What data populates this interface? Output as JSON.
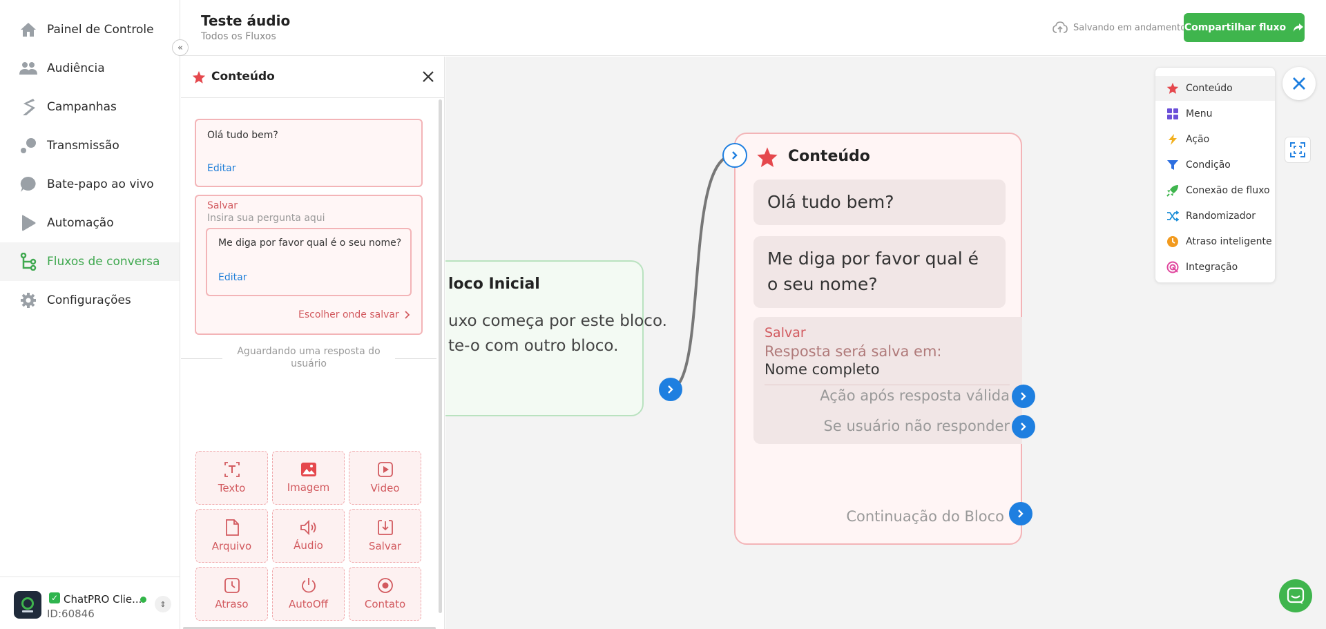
{
  "sidebar": {
    "items": [
      {
        "label": "Painel de Controle",
        "icon": "home-icon"
      },
      {
        "label": "Audiência",
        "icon": "people-icon"
      },
      {
        "label": "Campanhas",
        "icon": "campaign-icon"
      },
      {
        "label": "Transmissão",
        "icon": "broadcast-icon"
      },
      {
        "label": "Bate-papo ao vivo",
        "icon": "chat-bubble-icon"
      },
      {
        "label": "Automação",
        "icon": "play-icon"
      },
      {
        "label": "Fluxos de conversa",
        "icon": "flow-icon",
        "active": true
      },
      {
        "label": "Configurações",
        "icon": "gear-icon"
      }
    ],
    "footer": {
      "name": "ChatPRO Clie...",
      "id": "ID:60846"
    }
  },
  "header": {
    "title": "Teste áudio",
    "breadcrumb": "Todos os Fluxos",
    "saving": "Salvando em andamento",
    "share_label": "Compartilhar fluxo"
  },
  "panel": {
    "title": "Conteúdo",
    "message": "Olá tudo bem?",
    "edit_label": "Editar",
    "save_label": "Salvar",
    "save_placeholder": "Insira sua pergunta aqui",
    "question": "Me diga por favor qual é o seu nome?",
    "question_edit": "Editar",
    "choose_save": "Escolher onde salvar",
    "waiting": "Aguardando uma resposta do usuário",
    "buttons": [
      {
        "label": "Texto",
        "icon": "text-icon"
      },
      {
        "label": "Imagem",
        "icon": "image-icon"
      },
      {
        "label": "Video",
        "icon": "video-icon"
      },
      {
        "label": "Arquivo",
        "icon": "file-icon"
      },
      {
        "label": "Áudio",
        "icon": "audio-icon"
      },
      {
        "label": "Salvar",
        "icon": "save-icon"
      },
      {
        "label": "Atraso",
        "icon": "clock-icon"
      },
      {
        "label": "AutoOff",
        "icon": "power-icon"
      },
      {
        "label": "Contato",
        "icon": "contact-icon"
      }
    ]
  },
  "canvas": {
    "start_block": {
      "title": "loco Inicial",
      "line1": "uxo começa por este bloco.",
      "line2": "te-o com outro bloco."
    },
    "content_block": {
      "title": "Conteúdo",
      "bubble1": "Olá tudo bem?",
      "bubble2": "Me diga por favor qual é o seu nome?",
      "save_label": "Salvar",
      "response_saved": "Resposta será salva em:",
      "field": "Nome completo",
      "valid_action": "Ação após resposta válida",
      "no_response": "Se usuário não responder",
      "continuation": "Continuação do Bloco"
    }
  },
  "node_menu": {
    "items": [
      {
        "label": "Conteúdo",
        "icon": "star-icon",
        "color": "#e5484d"
      },
      {
        "label": "Menu",
        "icon": "grid-icon",
        "color": "#6b4fd8"
      },
      {
        "label": "Ação",
        "icon": "bolt-icon",
        "color": "#f2b01e"
      },
      {
        "label": "Condição",
        "icon": "filter-icon",
        "color": "#2d6fe0"
      },
      {
        "label": "Conexão de fluxo",
        "icon": "rocket-icon",
        "color": "#3fb54d"
      },
      {
        "label": "Randomizador",
        "icon": "shuffle-icon",
        "color": "#1d8fd8"
      },
      {
        "label": "Atraso inteligente",
        "icon": "clock-icon",
        "color": "#f29a1e"
      },
      {
        "label": "Integração",
        "icon": "integration-icon",
        "color": "#e0479e"
      }
    ]
  },
  "colors": {
    "accent_green": "#3fb54d",
    "content_red": "#e5484d",
    "link_blue": "#1e7ed8"
  }
}
